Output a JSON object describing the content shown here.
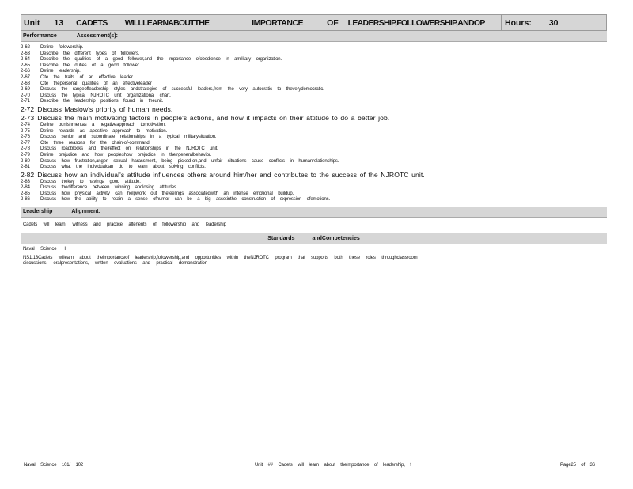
{
  "header": {
    "unit_label": "Unit",
    "unit_number": "13",
    "title_parts": [
      "CADETS",
      "WILLLEARNABOUTTHE",
      "IMPORTANCE",
      "OF",
      "LEADERSHIP,FOLLOWERSHIP,ANDOP"
    ],
    "hours_label": "Hours:",
    "hours_value": "30"
  },
  "performance_band": {
    "label": "Performance",
    "assessment_label": "Assessment(s):"
  },
  "objectives": [
    {
      "num": "2-62",
      "text": "Define followership."
    },
    {
      "num": "2-63",
      "text": "Describe the different types of followers."
    },
    {
      "num": "2-64",
      "text": "Describe the qualities of a good follower,and the importance ofobedience in amilitary organization."
    },
    {
      "num": "2-65",
      "text": "Describe the duties of a good follower."
    },
    {
      "num": "2-66",
      "text": "Define leadership."
    },
    {
      "num": "2-67",
      "text": "Cite the traits of an effective leader"
    },
    {
      "num": "2-68",
      "text": "Cite thepersonal qualities of an effectiveleader"
    },
    {
      "num": "2-69",
      "text": "Discuss the rangeofleadership styles andstrategies of successful leaders,from the very autocratic to theverydemocratic."
    },
    {
      "num": "2-70",
      "text": "Discuss the typical NJROTC unit organizational chart."
    },
    {
      "num": "2-71",
      "text": "Describe the leadership positions found in theunit."
    },
    {
      "num": "2-72",
      "text": "Discuss Maslow's priority of human needs.",
      "big": true
    },
    {
      "num": "2-73",
      "text": "Discuss the main motivating factors in people's actions, and how it impacts on their attitude to do a better job.",
      "big": true
    },
    {
      "num": "2-74",
      "text": "Define punishmentas a negativeapproach tomotivation."
    },
    {
      "num": "2-75",
      "text": "Define rewards as apositive approach to motivation."
    },
    {
      "num": "2-76",
      "text": "Discuss senior and subordinate relationships in a typical militarysituation."
    },
    {
      "num": "2-77",
      "text": "Cite three reasons for the chain-of-command."
    },
    {
      "num": "2-78",
      "text": "Discuss roadblocks and theireffect on relationships in the NJROTC unit."
    },
    {
      "num": "2-79",
      "text": "Define prejudice and how peopleshow prejudice in theirgeneralbehavior."
    },
    {
      "num": "2-80",
      "text": "Discuss how frustration,anger, sexual harassment, being picked-on,and unfair situations cause conflicts in humanrelationships."
    },
    {
      "num": "2-81",
      "text": "Discuss what the individualcan do to learn about solving conflicts."
    },
    {
      "num": "2-82",
      "text": "Discuss how an individual's attitude influences others around him/her and contributes to the success of the NJROTC unit.",
      "big": true
    },
    {
      "num": "2-83",
      "text": "Discuss thekey to havinga good attitude."
    },
    {
      "num": "2-84",
      "text": "Discuss thedifference between winning andlosing attitudes."
    },
    {
      "num": "2-85",
      "text": "Discuss how physical activity can helpwork out thefeelings associatedwith an intense emotional buildup."
    },
    {
      "num": "2-86",
      "text": "Discuss how the ability to retain a sense ofhumor can be a big assetinthe construction of expression ofemotions."
    }
  ],
  "leadership_band": {
    "label": "Leadership",
    "alignment_label": "Alignment:"
  },
  "alignment_text": "Cadets will learn, witness and practice altenents of followership and leadership",
  "standards_band": {
    "title_left": "Standards",
    "title_right": "andCompetencies"
  },
  "standards": {
    "subject_left": "Naval Science",
    "subject_right": "I",
    "line1": "NS1.13Cadets willearn about theimportanceof leadership,followership,and opportunities within theNJROTC program that supports both these roles throughclassroom",
    "line2": "discussions, oralpresentations, written evaluations and practical demonstration"
  },
  "footer": {
    "left": "Naval Science 101/ 102",
    "center": "Unit ## Cadets will learn about theimportance of leadership, f",
    "right": "Page25 of 36"
  }
}
